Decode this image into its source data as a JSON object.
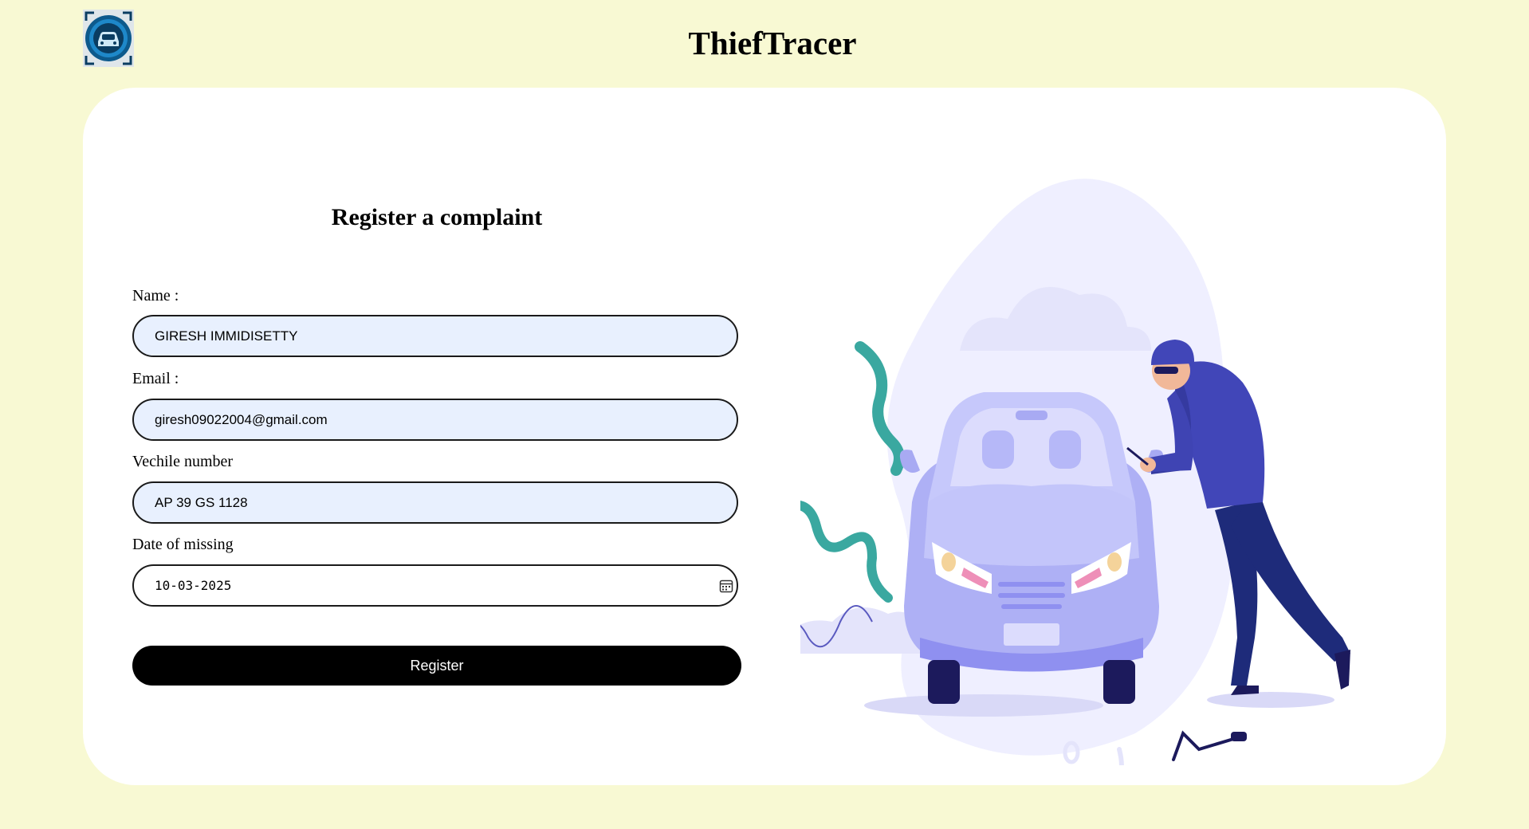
{
  "header": {
    "title": "ThiefTracer",
    "logo_icon": "car-scan-logo-icon"
  },
  "form": {
    "heading": "Register a complaint",
    "fields": {
      "name": {
        "label": "Name :",
        "value": "GIRESH IMMIDISETTY"
      },
      "email": {
        "label": "Email :",
        "value": "giresh09022004@gmail.com"
      },
      "vehicle": {
        "label": "Vechile number",
        "value": "AP 39 GS 1128"
      },
      "date": {
        "label": "Date of missing",
        "value": "10-03-2025",
        "icon": "calendar-icon"
      }
    },
    "submit_label": "Register"
  },
  "colors": {
    "page_bg": "#f8f9d3",
    "card_bg": "#ffffff",
    "input_bg": "#e8f0fe",
    "button_bg": "#000000",
    "illustration_accent": "#8f90f0"
  },
  "illustration": {
    "subject": "thief-breaking-into-car-illustration"
  }
}
